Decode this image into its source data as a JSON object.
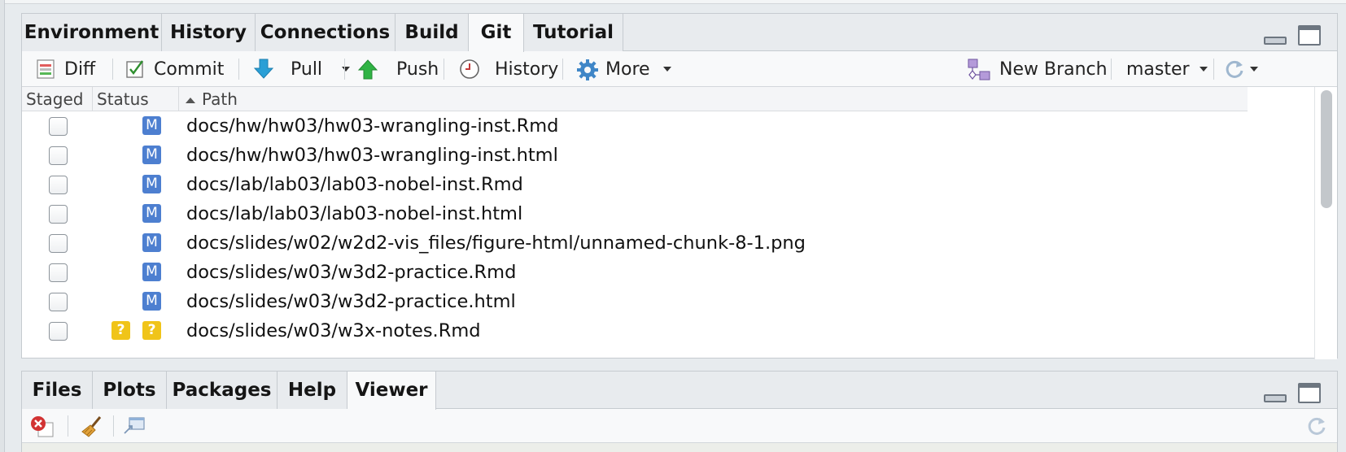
{
  "top_pane": {
    "tabs": [
      {
        "label": "Environment",
        "active": false
      },
      {
        "label": "History",
        "active": false
      },
      {
        "label": "Connections",
        "active": false
      },
      {
        "label": "Build",
        "active": false
      },
      {
        "label": "Git",
        "active": true
      },
      {
        "label": "Tutorial",
        "active": false
      }
    ],
    "toolbar": {
      "diff_label": "Diff",
      "commit_label": "Commit",
      "pull_label": "Pull",
      "push_label": "Push",
      "history_label": "History",
      "more_label": "More",
      "new_branch_label": "New Branch",
      "branch_value": "master"
    },
    "columns": {
      "staged": "Staged",
      "status": "Status",
      "path": "Path"
    },
    "files": [
      {
        "staged": false,
        "status": [
          "",
          "M"
        ],
        "path": "docs/hw/hw03/hw03-wrangling-inst.Rmd"
      },
      {
        "staged": false,
        "status": [
          "",
          "M"
        ],
        "path": "docs/hw/hw03/hw03-wrangling-inst.html"
      },
      {
        "staged": false,
        "status": [
          "",
          "M"
        ],
        "path": "docs/lab/lab03/lab03-nobel-inst.Rmd"
      },
      {
        "staged": false,
        "status": [
          "",
          "M"
        ],
        "path": "docs/lab/lab03/lab03-nobel-inst.html"
      },
      {
        "staged": false,
        "status": [
          "",
          "M"
        ],
        "path": "docs/slides/w02/w2d2-vis_files/figure-html/unnamed-chunk-8-1.png"
      },
      {
        "staged": false,
        "status": [
          "",
          "M"
        ],
        "path": "docs/slides/w03/w3d2-practice.Rmd"
      },
      {
        "staged": false,
        "status": [
          "",
          "M"
        ],
        "path": "docs/slides/w03/w3d2-practice.html"
      },
      {
        "staged": false,
        "status": [
          "?",
          "?"
        ],
        "path": "docs/slides/w03/w3x-notes.Rmd"
      }
    ]
  },
  "bottom_pane": {
    "tabs": [
      {
        "label": "Files",
        "active": false
      },
      {
        "label": "Plots",
        "active": false
      },
      {
        "label": "Packages",
        "active": false
      },
      {
        "label": "Help",
        "active": false
      },
      {
        "label": "Viewer",
        "active": true
      }
    ]
  },
  "colors": {
    "modified_badge": "#4d7fd0",
    "untracked_badge": "#f0c419",
    "pull_arrow": "#2a9fd6",
    "push_arrow": "#2fb344"
  }
}
